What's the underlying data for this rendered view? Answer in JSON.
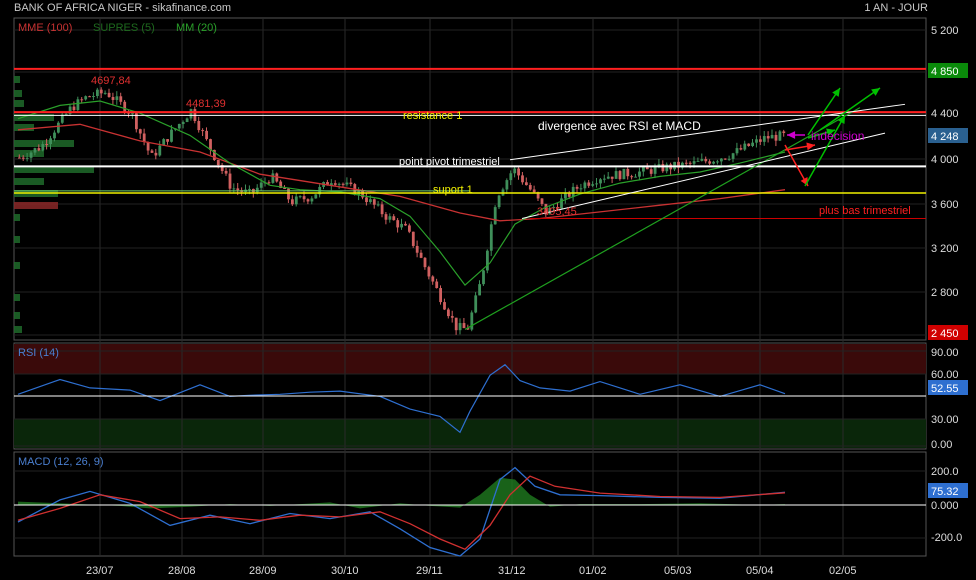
{
  "header": {
    "title": "BANK OF AFRICA NIGER - sikafinance.com",
    "period": "1 AN - JOUR"
  },
  "colors": {
    "up": "#3f8f5a",
    "down": "#d06060",
    "mme": "#c83232",
    "supres": "#1e5a1e",
    "mm": "#2aa02a",
    "rsi": "#2e6fd0",
    "macd_signal": "#d03030",
    "histogram": "#1f7a1f",
    "annotation_yellow": "#f0f000",
    "annotation_red": "#ff0000",
    "annotation_green": "#00c000",
    "annotation_magenta": "#d000d0"
  },
  "main_panel": {
    "legend": [
      {
        "label": "MME (100)",
        "color": "#c83232"
      },
      {
        "label": "SUPRES (5)",
        "color": "#1e5a1e"
      },
      {
        "label": "MM (20)",
        "color": "#2aa02a"
      }
    ],
    "y_ticks": [
      "5 200",
      "4 800",
      "4 400",
      "4 000",
      "3 600",
      "3 200",
      "2 800"
    ],
    "price_flags": [
      {
        "label": "4 850",
        "value": 4850,
        "bg": "#0a8a0a"
      },
      {
        "label": "4 248",
        "value": 4248,
        "bg": "#2a6090"
      },
      {
        "label": "2 450",
        "value": 2450,
        "bg": "#d00000"
      }
    ],
    "point_labels": [
      {
        "text": "4697,84",
        "value": 4697.84
      },
      {
        "text": "4481,39",
        "value": 4481.39
      },
      {
        "text": "3495,45",
        "value": 3495.45
      }
    ],
    "annotations": {
      "resistance": "resistance 1",
      "pivot": "point pivot trimestriel",
      "support": "suport 1",
      "divergence": "divergence avec RSI et MACD",
      "indecision": "indecision",
      "lowest": "plus bas trimestriel"
    }
  },
  "rsi_panel": {
    "legend": "RSI (14)",
    "y_ticks": [
      "90.00",
      "60.00",
      "30.00",
      "0.00"
    ],
    "current": "52.55"
  },
  "macd_panel": {
    "legend": "MACD (12, 26, 9)",
    "y_ticks": [
      "200.0",
      "0.000",
      "-200.0"
    ],
    "current": "75.32"
  },
  "x_axis": {
    "labels": [
      "23/07",
      "28/08",
      "28/09",
      "30/10",
      "29/11",
      "31/12",
      "01/02",
      "05/03",
      "05/04",
      "02/05"
    ]
  },
  "chart_data": [
    {
      "type": "candlestick",
      "title": "BANK OF AFRICA NIGER",
      "ylim": [
        2400,
        5300
      ],
      "x": [
        "23/07",
        "28/08",
        "28/09",
        "30/10",
        "29/11",
        "31/12",
        "01/02",
        "05/03",
        "05/04",
        "02/05"
      ],
      "series": [
        {
          "name": "MME (100)",
          "values": [
            4250,
            4150,
            3900,
            3750,
            3600,
            3650,
            3750,
            3800,
            3850,
            null
          ]
        },
        {
          "name": "MM (20)",
          "values": [
            4300,
            4200,
            3900,
            3750,
            2900,
            3650,
            3800,
            3900,
            4050,
            null
          ]
        }
      ],
      "close": [
        4450,
        4350,
        3750,
        3700,
        2500,
        3950,
        3900,
        3950,
        4248,
        null
      ],
      "levels": [
        {
          "name": "resistance 1",
          "value": 4460
        },
        {
          "name": "point pivot trimestriel",
          "value": 3970
        },
        {
          "name": "suport 1",
          "value": 3730
        },
        {
          "name": "plus bas trimestriel",
          "value": 3500
        }
      ]
    },
    {
      "type": "line",
      "title": "RSI (14)",
      "ylim": [
        0,
        100
      ],
      "x": [
        "23/07",
        "28/08",
        "28/09",
        "30/10",
        "29/11",
        "31/12",
        "01/02",
        "05/03",
        "05/04",
        "02/05"
      ],
      "series": [
        {
          "name": "RSI (14)",
          "values": [
            56,
            48,
            45,
            50,
            20,
            68,
            55,
            52,
            52.55,
            null
          ]
        }
      ]
    },
    {
      "type": "line",
      "title": "MACD (12, 26, 9)",
      "ylim": [
        -300,
        250
      ],
      "x": [
        "23/07",
        "28/08",
        "28/09",
        "30/10",
        "29/11",
        "31/12",
        "01/02",
        "05/03",
        "05/04",
        "02/05"
      ],
      "series": [
        {
          "name": "MACD",
          "values": [
            30,
            -80,
            -60,
            -70,
            -300,
            220,
            60,
            40,
            75.32,
            null
          ]
        },
        {
          "name": "signal",
          "values": [
            10,
            -40,
            -70,
            -50,
            -230,
            120,
            80,
            45,
            70,
            null
          ]
        }
      ]
    }
  ]
}
